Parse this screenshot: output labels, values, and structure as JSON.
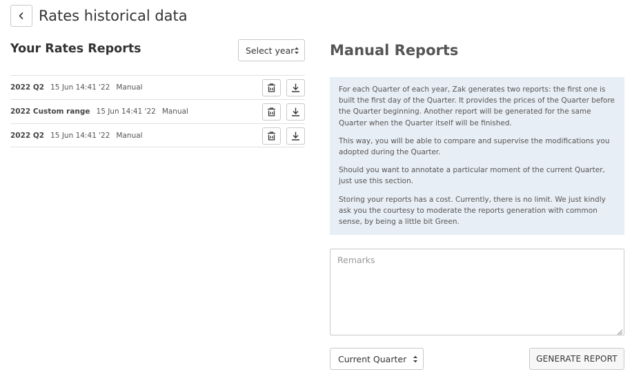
{
  "header": {
    "title": "Rates historical data",
    "back_icon": "chevron-left-icon"
  },
  "left": {
    "title": "Your Rates Reports",
    "year_select": "Select year",
    "reports": [
      {
        "name": "2022 Q2",
        "date": "15 Jun 14:41 '22",
        "type": "Manual"
      },
      {
        "name": "2022 Custom range",
        "date": "15 Jun 14:41 '22",
        "type": "Manual"
      },
      {
        "name": "2022 Q2",
        "date": "15 Jun 14:41 '22",
        "type": "Manual"
      }
    ]
  },
  "right": {
    "title": "Manual Reports",
    "info": [
      "For each Quarter of each year, Zak generates two reports: the first one is built the first day of the Quarter. It provides the prices of the Quarter before the Quarter beginning. Another report will be generated for the same Quarter when the Quarter itself will be finished.",
      "This way, you will be able to compare and supervise the modifications you adopted during the Quarter.",
      "Should you want to annotate a particular moment of the current Quarter, just use this section.",
      "Storing your reports has a cost. Currently, there is no limit. We just kindly ask you the courtesy to moderate the reports generation with common sense, by being a little bit Green."
    ],
    "remarks_placeholder": "Remarks",
    "quarter_select": "Current Quarter",
    "generate_label": "GENERATE REPORT"
  },
  "colors": {
    "info_bg": "#e8eef5",
    "border": "#c8c8c8",
    "text": "#333333"
  }
}
